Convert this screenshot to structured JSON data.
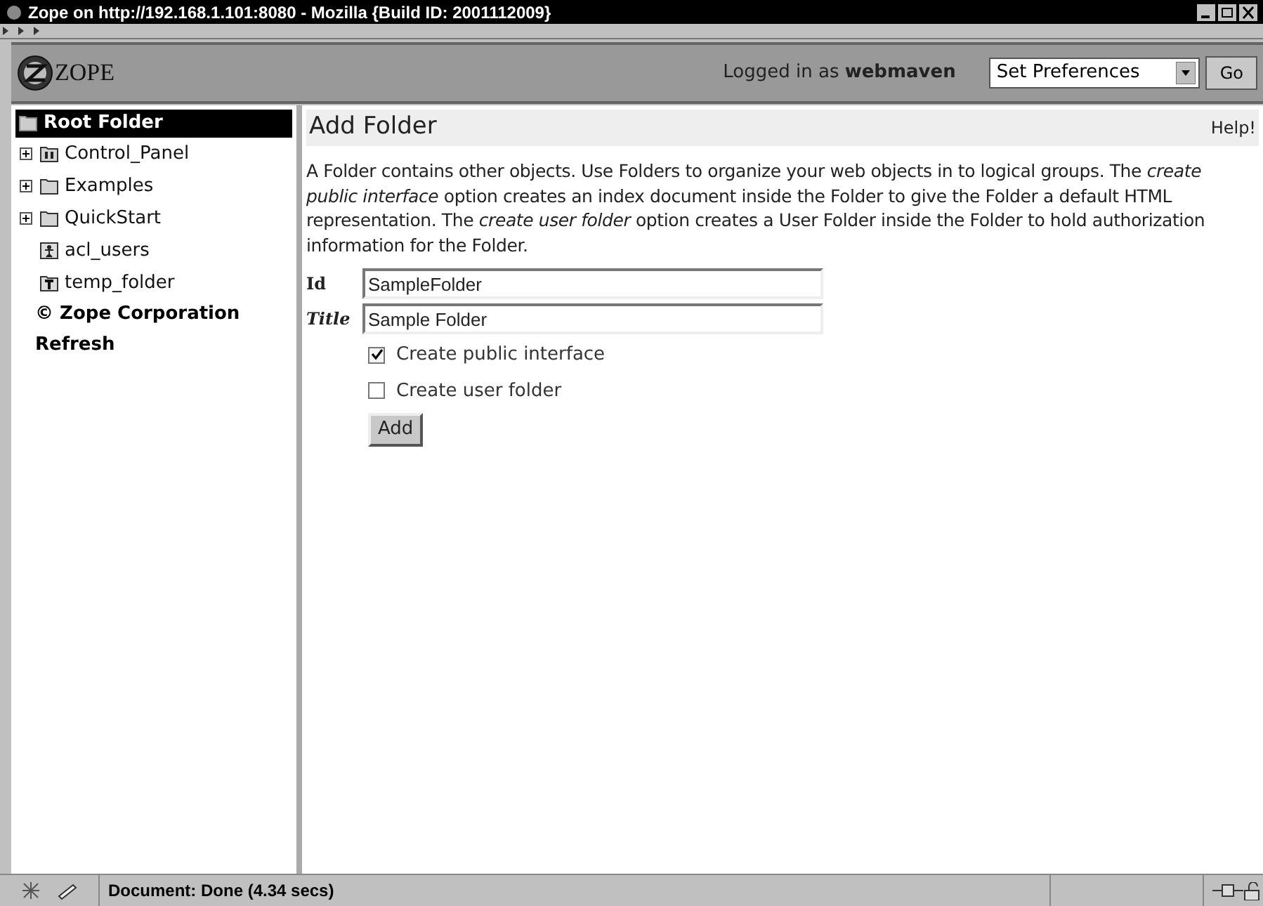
{
  "window": {
    "title": "Zope on http://192.168.1.101:8080 - Mozilla {Build ID: 2001112009}"
  },
  "header": {
    "logo": "ZOPE",
    "logged_in": "Logged in as **webmaven**",
    "preferences": "Set Preferences",
    "go_button": "Go"
  },
  "sidebar": {
    "root": {
      "label": "Root Folder",
      "selected": true
    },
    "items": [
      {
        "label": "Control_Panel",
        "kind": "control",
        "expandable": true
      },
      {
        "label": "Examples",
        "kind": "folder",
        "expandable": true
      },
      {
        "label": "QuickStart",
        "kind": "folder",
        "expandable": true
      },
      {
        "label": "acl_users",
        "kind": "users",
        "expandable": false
      },
      {
        "label": "temp_folder",
        "kind": "temp",
        "expandable": false
      }
    ],
    "footer_links": [
      "© Zope Corporation",
      "Refresh"
    ]
  },
  "main": {
    "heading": "Add Folder",
    "help": "Help!",
    "description": "A Folder contains other objects. Use Folders to organize your web objects in to logical groups. The *create public interface* option creates an index document inside the Folder to give the Folder a default HTML representation. The *create user folder* option creates a User Folder inside the Folder to hold authorization information for the Folder.",
    "fields": [
      {
        "label": "Id",
        "italic": false,
        "value": "SampleFolder"
      },
      {
        "label": "Title",
        "italic": true,
        "value": "Sample Folder"
      }
    ],
    "options": [
      {
        "label": "Create public interface",
        "checked": true
      },
      {
        "label": "Create user folder",
        "checked": false
      }
    ],
    "submit": "Add"
  },
  "status_bar": {
    "text": "Document: Done (4.34 secs)"
  }
}
